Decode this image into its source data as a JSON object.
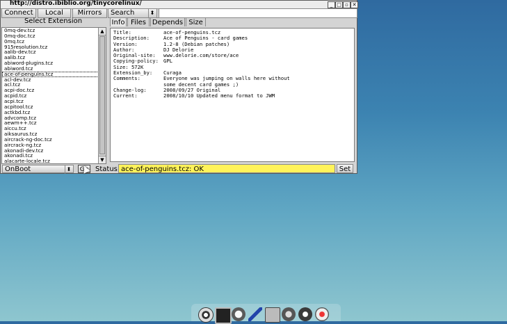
{
  "window": {
    "title": "http://distro.ibiblio.org/tinycorelinux/",
    "controls": {
      "minimize": "_",
      "maximize": "□",
      "close": "✕"
    }
  },
  "toolbar": {
    "connect": "Connect",
    "local": "Local",
    "mirrors": "Mirrors",
    "search_mode": "Search",
    "search_value": ""
  },
  "left": {
    "label": "Select Extension",
    "items": [
      "0mq-dev.tcz",
      "0mq-doc.tcz",
      "0mq.tcz",
      "915resolution.tcz",
      "aalib-dev.tcz",
      "aalib.tcz",
      "abiword-plugins.tcz",
      "abiword.tcz",
      "ace-of-penguins.tcz",
      "acl-dev.tcz",
      "acl.tcz",
      "acpi-doc.tcz",
      "acpid.tcz",
      "acpi.tcz",
      "acpitool.tcz",
      "actkbd.tcz",
      "advcomp.tcz",
      "aewm++.tcz",
      "aiccu.tcz",
      "aiksaurus.tcz",
      "aircrack-ng-doc.tcz",
      "aircrack-ng.tcz",
      "akonadi-dev.tcz",
      "akonadi.tcz",
      "alacarte-locale.tcz"
    ],
    "selected_index": 8
  },
  "tabs": [
    "Info",
    "Files",
    "Depends",
    "Size"
  ],
  "info": [
    {
      "k": "Title:",
      "v": "ace-of-penguins.tcz"
    },
    {
      "k": "Description:",
      "v": "Ace of Penguins - card games"
    },
    {
      "k": "Version:",
      "v": "1.2-8 (Debian patches)"
    },
    {
      "k": "Author:",
      "v": "DJ Delorie"
    },
    {
      "k": "Original-site:",
      "v": "www.delorie.com/store/ace"
    },
    {
      "k": "Copying-policy:",
      "v": "GPL"
    },
    {
      "k": "Size: 572K",
      "v": ""
    },
    {
      "k": "Extension_by:",
      "v": "Curaga"
    },
    {
      "k": "Comments:",
      "v": "Everyone was jumping on walls here without"
    },
    {
      "k": "",
      "v": "some decent card games ;)"
    },
    {
      "k": "Change-log:",
      "v": "2008/09/27 Original"
    },
    {
      "k": "Current:",
      "v": "2008/10/10 Updated menu format to JWM"
    }
  ],
  "bottom": {
    "onboot": "OnBoot",
    "go": "Go",
    "status_label": "Status",
    "status_value": "ace-of-penguins.tcz: OK",
    "set": "Set"
  },
  "dock_icons": [
    "power-icon",
    "terminal-icon",
    "editor-icon",
    "pen-icon",
    "control-panel-icon",
    "mount-icon",
    "run-icon",
    "apps-icon"
  ]
}
